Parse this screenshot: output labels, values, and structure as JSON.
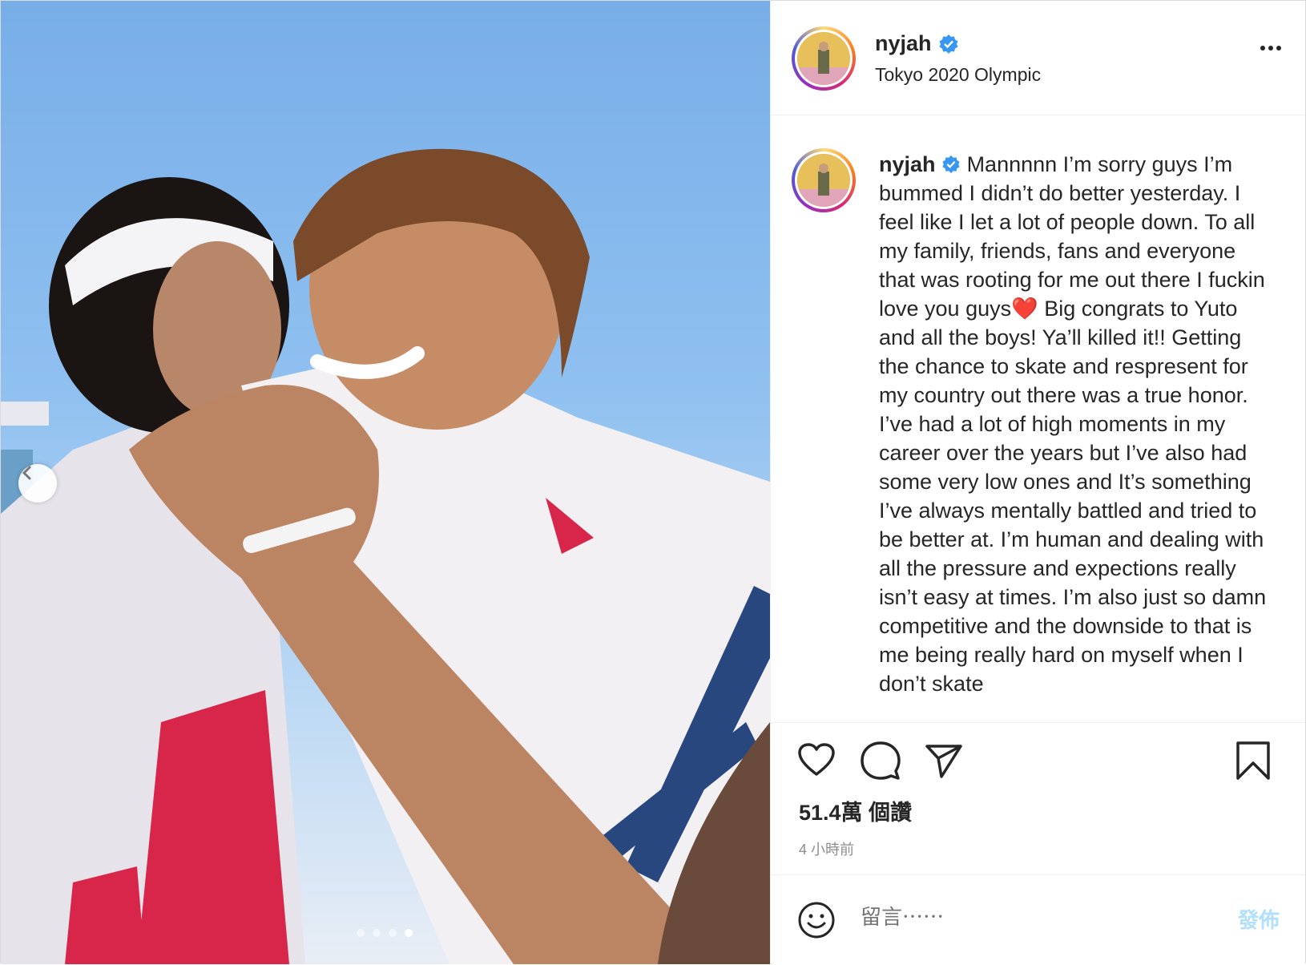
{
  "header": {
    "username": "nyjah",
    "location": "Tokyo 2020 Olympic"
  },
  "caption": {
    "username": "nyjah",
    "text_before_heart": "Mannnnn I’m sorry guys I’m bummed I didn’t do better yesterday. I feel like I let a lot of people down. To all my family, friends, fans and everyone that was rooting for me out there I fuckin love you guys",
    "heart_emoji": "❤️",
    "text_after_heart": " Big congrats to Yuto and all the boys! Ya’ll killed it!! Getting the chance to skate and respresent for my country out there was a true honor. I’ve had a lot of high moments in my career over the years but I’ve also had some very low ones and It’s something I’ve always mentally battled and tried to be better at. I’m human and dealing with all the pressure and expections really isn’t easy at times. I’m also just so damn competitive and the downside to that is me being really hard on myself when I don’t skate"
  },
  "stats": {
    "likes": "51.4萬 個讚",
    "time_ago": "4 小時前"
  },
  "comment": {
    "placeholder": "留言⋯⋯",
    "post_label": "發佈"
  },
  "carousel": {
    "count": 4,
    "active_index": 3
  },
  "icons": {
    "verified": "verified-badge-icon",
    "more": "more-options-icon",
    "like": "heart-icon",
    "comment": "comment-bubble-icon",
    "share": "paper-plane-icon",
    "save": "bookmark-icon",
    "emoji": "smiley-icon",
    "prev": "chevron-left-icon"
  },
  "colors": {
    "verified": "#3897f0",
    "text": "#262626",
    "muted": "#8e8e8e",
    "post_button": "#b2dffc"
  }
}
